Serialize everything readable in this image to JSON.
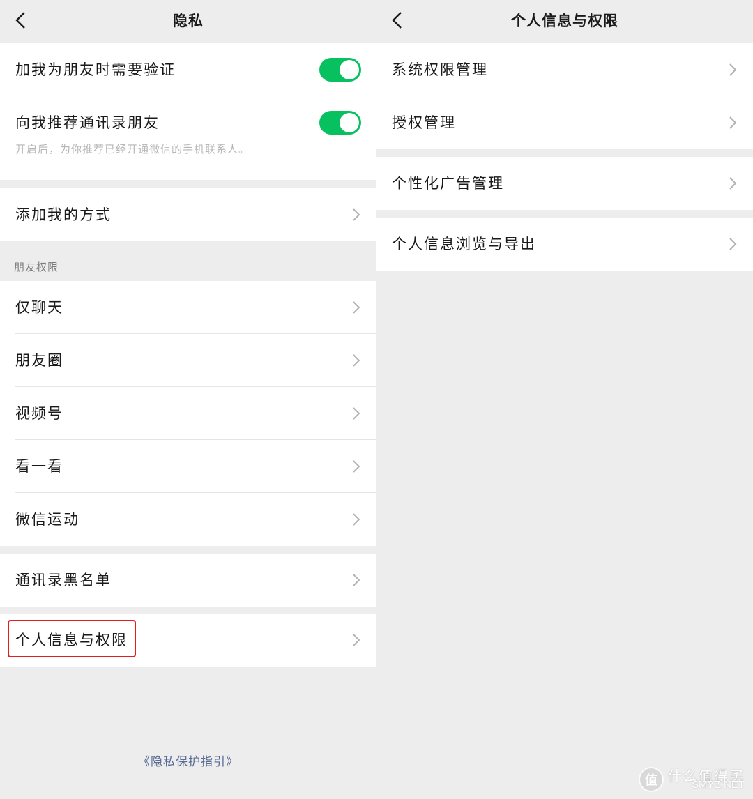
{
  "left": {
    "title": "隐私",
    "add_verify": {
      "label": "加我为朋友时需要验证",
      "on": true
    },
    "recommend_contacts": {
      "label": "向我推荐通讯录朋友",
      "on": true,
      "hint": "开启后，为你推荐已经开通微信的手机联系人。"
    },
    "add_methods": "添加我的方式",
    "friend_permissions_header": "朋友权限",
    "friend_permissions": [
      "仅聊天",
      "朋友圈",
      "视频号",
      "看一看",
      "微信运动"
    ],
    "blacklist": "通讯录黑名单",
    "personal_info": "个人信息与权限",
    "privacy_guide": "《隐私保护指引》"
  },
  "right": {
    "title": "个人信息与权限",
    "items": [
      "系统权限管理",
      "授权管理",
      "个性化广告管理",
      "个人信息浏览与导出"
    ]
  },
  "watermark": {
    "logo": "值",
    "cn": "什么值得买",
    "en": "SMYZ.NET"
  },
  "colors": {
    "toggle_on": "#07c160",
    "highlight": "#e02020",
    "link": "#576b95"
  },
  "icons": {
    "back": "chevron-left-icon",
    "arrow": "chevron-right-icon",
    "logo": "zhi-logo-icon"
  }
}
